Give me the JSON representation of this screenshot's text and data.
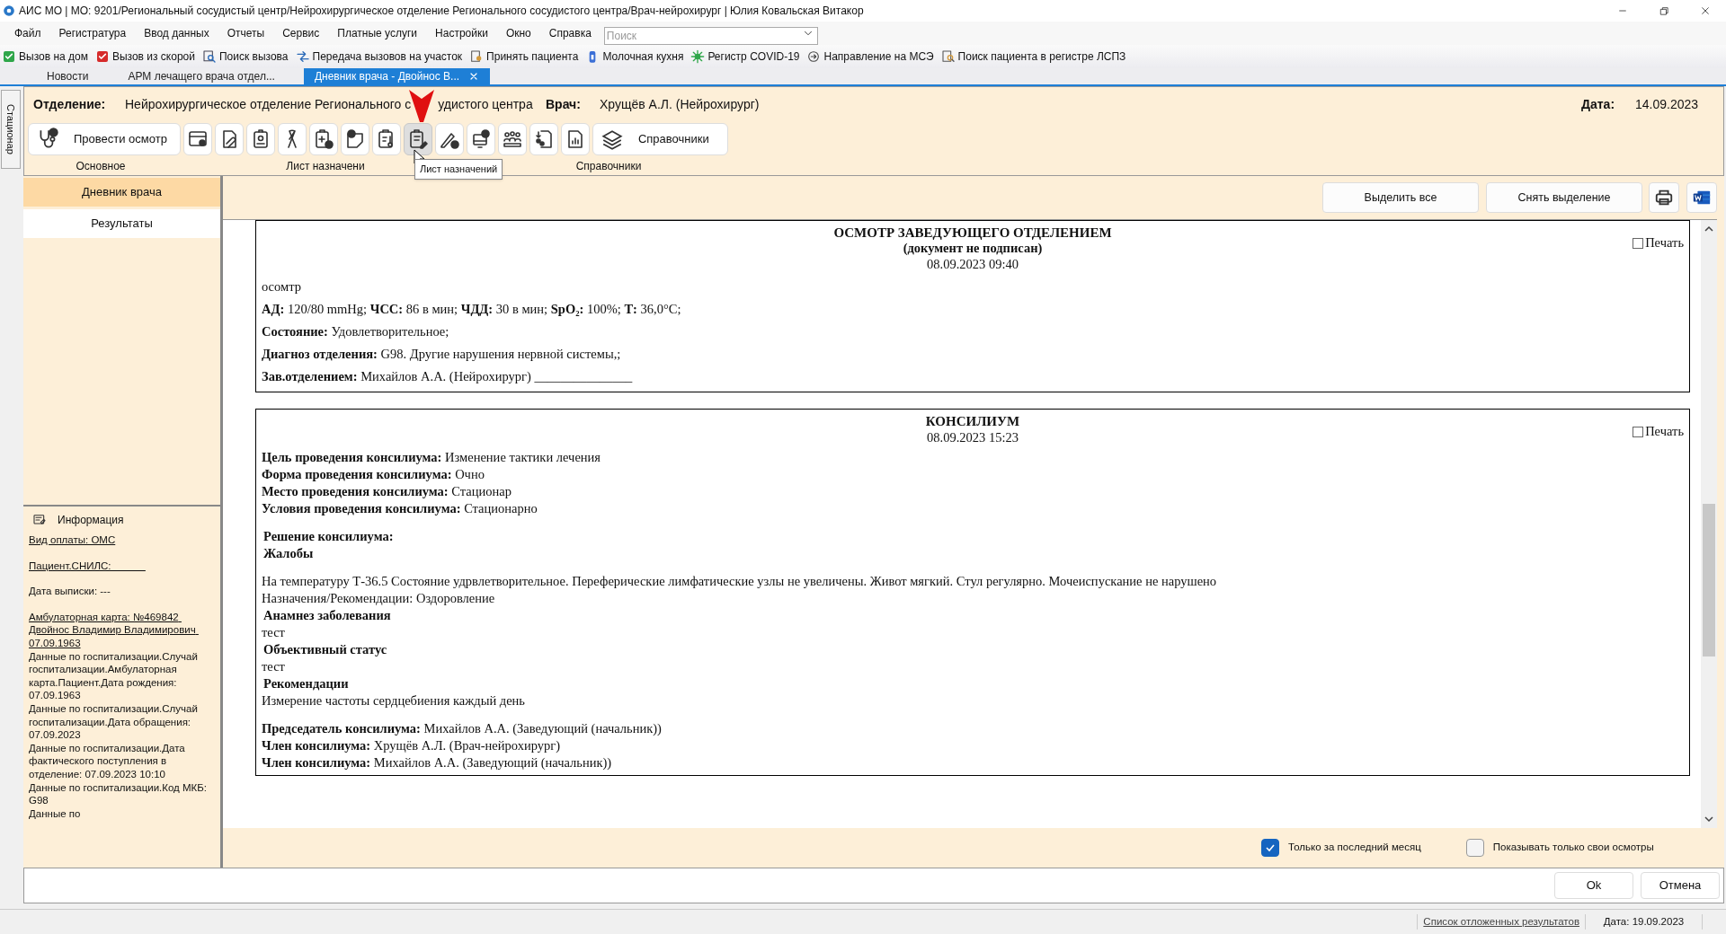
{
  "window": {
    "title": "АИС МО | МО: 9201/Региональный сосудистый центр/Нейрохирургическое отделение Регионального сосудистого центра/Врач-нейрохирург | Юлия Ковальская Витакор"
  },
  "menu": [
    "Файл",
    "Регистратура",
    "Ввод данных",
    "Отчеты",
    "Сервис",
    "Платные услуги",
    "Настройки",
    "Окно",
    "Справка"
  ],
  "search": {
    "placeholder": "Поиск"
  },
  "quick_toolbar": [
    "Вызов на дом",
    "Вызов из скорой",
    "Поиск вызова",
    "Передача вызовов на участок",
    "Принять пациента",
    "Молочная кухня",
    "Регистр COVID-19",
    "Направление на МСЭ",
    "Поиск пациента в регистре ЛСПЗ"
  ],
  "tabs": [
    {
      "label": "Новости",
      "selected": false,
      "closable": false
    },
    {
      "label": "АРМ лечащего врача отдел...",
      "selected": false,
      "closable": false
    },
    {
      "label": "Дневник врача - Двойнос В...",
      "selected": true,
      "closable": true
    }
  ],
  "side_tab": "Стационар",
  "header": {
    "department_label": "Отделение:",
    "department": [
      "Нейрохирургическое отделение Регионального с",
      "удистого центра"
    ],
    "doctor_label": "Врач:",
    "doctor": "Хрущёв А.Л. (Нейрохирург)",
    "date_label": "Дата:",
    "date": "14.09.2023"
  },
  "ribbon": {
    "first_button": "Провести осмотр",
    "icon_buttons": [
      {
        "hovered": false
      },
      {
        "hovered": false
      },
      {
        "hovered": false
      },
      {
        "hovered": false
      },
      {
        "hovered": false
      },
      {
        "hovered": false
      },
      {
        "hovered": false
      },
      {
        "hovered": true
      },
      {
        "hovered": false
      },
      {
        "hovered": false
      },
      {
        "hovered": false
      },
      {
        "hovered": false
      },
      {
        "hovered": false
      }
    ],
    "last_button": "Справочники",
    "groups": [
      "Основное",
      "Лист назначени",
      "Справочники"
    ],
    "tooltip": "Лист назначений"
  },
  "nav": [
    {
      "label": "Дневник врача",
      "selected": true
    },
    {
      "label": "Результаты",
      "selected": false
    }
  ],
  "info": {
    "title": "Информация",
    "blocks": [
      [
        {
          "text": "Вид оплаты: ОМС",
          "kind": "link"
        }
      ],
      [
        {
          "text": "Пациент.СНИЛС:            ",
          "kind": "link"
        }
      ],
      [
        {
          "text": "Дата выписки: ---",
          "kind": "text"
        }
      ],
      [
        {
          "text": "Амбулаторная карта: №469842 Двойнос Владимир Владимирович 07.09.1963",
          "kind": "link"
        },
        {
          "text": "Данные по госпитализации.Случай госпитализации.Амбулаторная карта.Пациент.Дата рождения: 07.09.1963",
          "kind": "text"
        },
        {
          "text": "Данные по госпитализации.Случай госпитализации.Дата обращения: 07.09.2023",
          "kind": "text"
        },
        {
          "text": "Данные по госпитализации.Дата фактического поступления в отделение: 07.09.2023 10:10",
          "kind": "text"
        },
        {
          "text": "Данные по госпитализации.Код МКБ: G98",
          "kind": "text"
        },
        {
          "text": "Данные по",
          "kind": "text"
        }
      ]
    ]
  },
  "actions": [
    "Выделить все",
    "Снять выделение"
  ],
  "documents": [
    {
      "title": "ОСМОТР ЗАВЕДУЮЩЕГО ОТДЕЛЕНИЕМ",
      "subtitle": "(документ не подписан)",
      "date": "08.09.2023 09:40",
      "print_label": "Печать",
      "print_checked": false,
      "blocks": [
        [
          {
            "kind": "text",
            "text": "осомтр"
          },
          {
            "kind": "text",
            "text": "**АД:** 120/80 mmHg; **ЧСС:** 86 в мин; **ЧДД:** 30 в мин; **SpO₂:** 100%; **Т:** 36,0°С;"
          },
          {
            "kind": "text",
            "text": "**Состояние:** Удовлетворительное;"
          },
          {
            "kind": "text",
            "text": "**Диагноз отделения:** G98. Другие нарушения нервной системы,;"
          },
          {
            "kind": "text",
            "text": "**Зав.отделением:** Михайлов А.А. (Нейрохирург) _______________"
          }
        ]
      ]
    },
    {
      "title": "КОНСИЛИУМ",
      "date": "08.09.2023 15:23",
      "print_label": "Печать",
      "print_checked": false,
      "blocks": [
        [
          {
            "kind": "text",
            "text": "**Цель проведения консилиума:** Изменение тактики лечения"
          },
          {
            "kind": "text",
            "text": "**Форма проведения консилиума:** Очно"
          },
          {
            "kind": "text",
            "text": "**Место проведения консилиума:** Стационар"
          },
          {
            "kind": "text",
            "text": "**Условия проведения консилиума:** Стационарно"
          }
        ],
        [
          {
            "kind": "heading",
            "text": "Решение консилиума:"
          },
          {
            "kind": "heading",
            "text": "Жалобы"
          }
        ],
        [
          {
            "kind": "text",
            "text": "На температуру Т-36.5 Состояние удрвлетворительное. Переферические лимфатические узлы не увеличены. Живот мягкий. Стул регулярно. Мочеиспускание не нарушено"
          },
          {
            "kind": "text",
            "text": "Назначения/Рекомендации: Оздоровление"
          },
          {
            "kind": "heading",
            "text": "Анамнез заболевания"
          },
          {
            "kind": "text",
            "text": "тест"
          },
          {
            "kind": "heading",
            "text": "Объективный статус"
          },
          {
            "kind": "text",
            "text": "тест"
          },
          {
            "kind": "heading",
            "text": "Рекомендации"
          },
          {
            "kind": "text",
            "text": "Измерение частоты сердцебиения каждый день"
          }
        ],
        [
          {
            "kind": "text",
            "text": "**Председатель консилиума:** Михайлов А.А. (Заведующий (начальник))"
          },
          {
            "kind": "text",
            "text": "**Член консилиума:** Хрущёв А.Л. (Врач-нейрохирург)"
          },
          {
            "kind": "text",
            "text": "**Член консилиума:** Михайлов А.А. (Заведующий (начальник))"
          }
        ]
      ]
    }
  ],
  "filters": [
    {
      "label": "Только за последний месяц",
      "checked": true
    },
    {
      "label": "Показывать только свои осмотры",
      "checked": false
    }
  ],
  "dialog_buttons": [
    "Ok",
    "Отмена"
  ],
  "status_bar": {
    "link": "Список отложенных результатов",
    "date": "Дата: 19.09.2023"
  }
}
